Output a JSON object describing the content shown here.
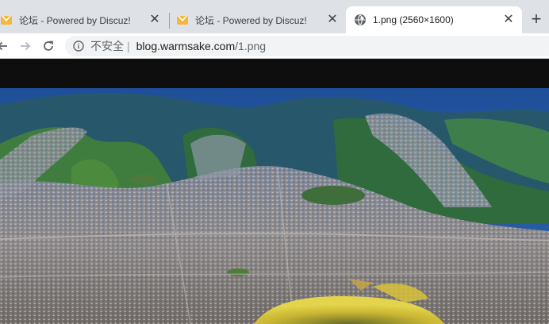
{
  "tabs": [
    {
      "title": "论坛 - Powered by Discuz!",
      "favicon": "discuz-favicon-icon",
      "active": false
    },
    {
      "title": "论坛 - Powered by Discuz!",
      "favicon": "discuz-favicon-icon",
      "active": false
    },
    {
      "title": "1.png (2560×1600)",
      "favicon": "globe-icon",
      "active": true
    }
  ],
  "close_glyph": "✕",
  "newtab_glyph": "+",
  "toolbar": {
    "back_icon": "back-arrow-icon",
    "forward_icon": "forward-arrow-icon",
    "reload_icon": "reload-icon"
  },
  "omnibox": {
    "security_icon": "info-circle-icon",
    "security_label": "不安全",
    "separator": "|",
    "host": "blog.warmsake.com",
    "path": "/1.png"
  },
  "image": {
    "alt": "aerial-city-valley-photo",
    "colors": {
      "sky": "#2b5aa8",
      "mountain": "#2f6b3c",
      "city": "#9a9aa0",
      "crater": "#d8c23a"
    }
  }
}
